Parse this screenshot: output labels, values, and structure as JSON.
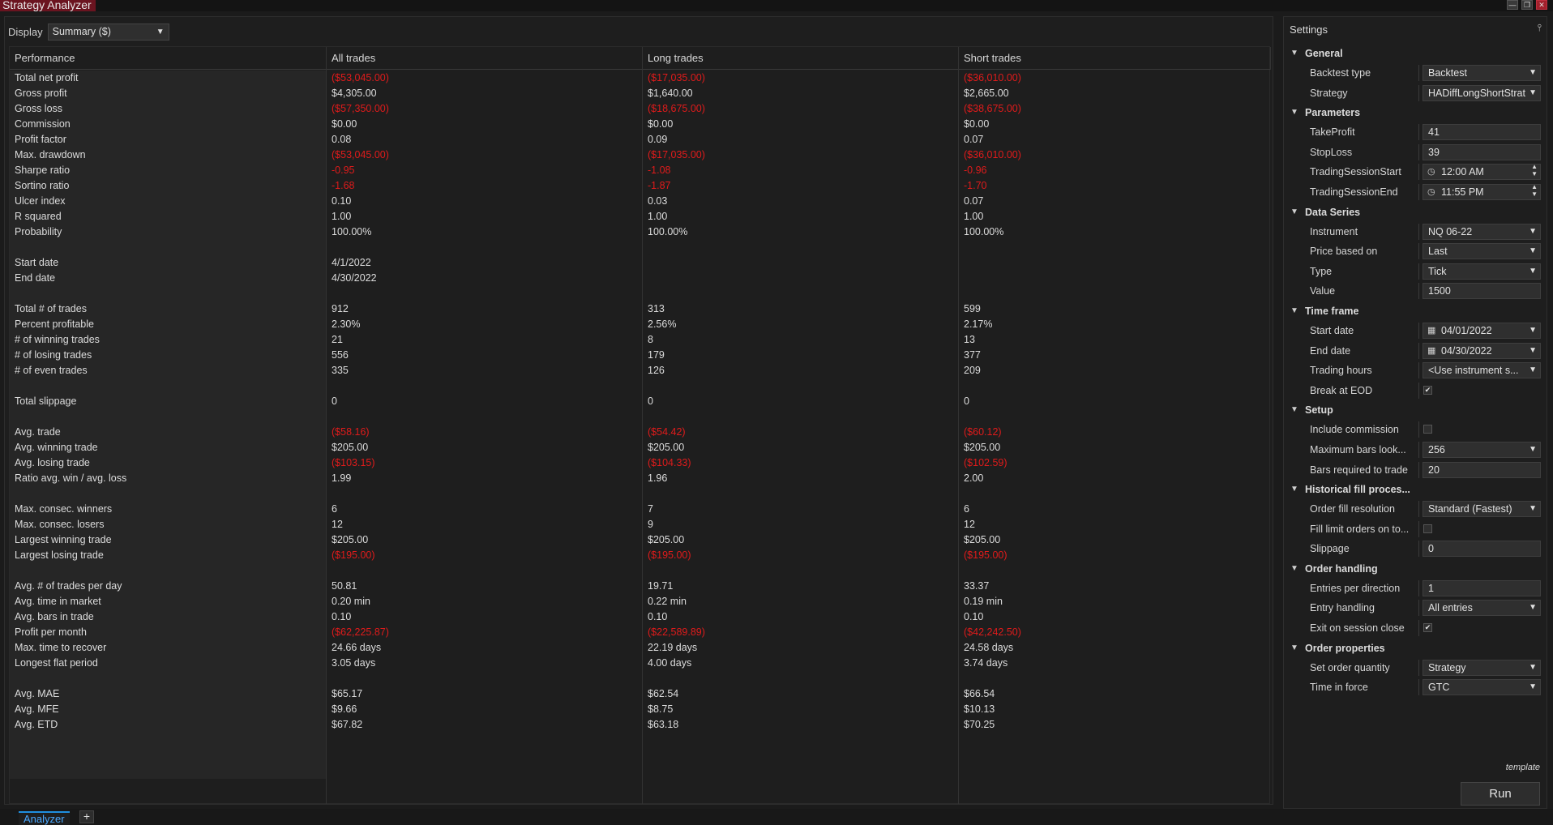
{
  "window": {
    "title": "Strategy Analyzer",
    "min_glyph": "—",
    "restore_glyph": "❐",
    "close_glyph": "✕"
  },
  "display": {
    "label": "Display",
    "selected": "Summary ($)"
  },
  "table": {
    "headers": [
      "Performance",
      "All trades",
      "Long trades",
      "Short trades"
    ],
    "rows": [
      {
        "label": "Total net profit",
        "all": "($53,045.00)",
        "long": "($17,035.00)",
        "short": "($36,010.00)"
      },
      {
        "label": "Gross profit",
        "all": "$4,305.00",
        "long": "$1,640.00",
        "short": "$2,665.00"
      },
      {
        "label": "Gross loss",
        "all": "($57,350.00)",
        "long": "($18,675.00)",
        "short": "($38,675.00)"
      },
      {
        "label": "Commission",
        "all": "$0.00",
        "long": "$0.00",
        "short": "$0.00"
      },
      {
        "label": "Profit factor",
        "all": "0.08",
        "long": "0.09",
        "short": "0.07"
      },
      {
        "label": "Max. drawdown",
        "all": "($53,045.00)",
        "long": "($17,035.00)",
        "short": "($36,010.00)"
      },
      {
        "label": "Sharpe ratio",
        "all": "-0.95",
        "long": "-1.08",
        "short": "-0.96"
      },
      {
        "label": "Sortino ratio",
        "all": "-1.68",
        "long": "-1.87",
        "short": "-1.70"
      },
      {
        "label": "Ulcer index",
        "all": "0.10",
        "long": "0.03",
        "short": "0.07"
      },
      {
        "label": "R squared",
        "all": "1.00",
        "long": "1.00",
        "short": "1.00"
      },
      {
        "label": "Probability",
        "all": "100.00%",
        "long": "100.00%",
        "short": "100.00%"
      },
      {
        "label": "",
        "all": "",
        "long": "",
        "short": ""
      },
      {
        "label": "Start date",
        "all": "4/1/2022",
        "long": "",
        "short": ""
      },
      {
        "label": "End date",
        "all": "4/30/2022",
        "long": "",
        "short": ""
      },
      {
        "label": "",
        "all": "",
        "long": "",
        "short": ""
      },
      {
        "label": "Total # of trades",
        "all": "912",
        "long": "313",
        "short": "599"
      },
      {
        "label": "Percent profitable",
        "all": "2.30%",
        "long": "2.56%",
        "short": "2.17%"
      },
      {
        "label": "# of winning trades",
        "all": "21",
        "long": "8",
        "short": "13"
      },
      {
        "label": "# of losing trades",
        "all": "556",
        "long": "179",
        "short": "377"
      },
      {
        "label": "# of even trades",
        "all": "335",
        "long": "126",
        "short": "209"
      },
      {
        "label": "",
        "all": "",
        "long": "",
        "short": ""
      },
      {
        "label": "Total slippage",
        "all": "0",
        "long": "0",
        "short": "0"
      },
      {
        "label": "",
        "all": "",
        "long": "",
        "short": ""
      },
      {
        "label": "Avg. trade",
        "all": "($58.16)",
        "long": "($54.42)",
        "short": "($60.12)"
      },
      {
        "label": "Avg. winning trade",
        "all": "$205.00",
        "long": "$205.00",
        "short": "$205.00"
      },
      {
        "label": "Avg. losing trade",
        "all": "($103.15)",
        "long": "($104.33)",
        "short": "($102.59)"
      },
      {
        "label": "Ratio avg. win / avg. loss",
        "all": "1.99",
        "long": "1.96",
        "short": "2.00"
      },
      {
        "label": "",
        "all": "",
        "long": "",
        "short": ""
      },
      {
        "label": "Max. consec. winners",
        "all": "6",
        "long": "7",
        "short": "6"
      },
      {
        "label": "Max. consec. losers",
        "all": "12",
        "long": "9",
        "short": "12"
      },
      {
        "label": "Largest winning trade",
        "all": "$205.00",
        "long": "$205.00",
        "short": "$205.00"
      },
      {
        "label": "Largest losing trade",
        "all": "($195.00)",
        "long": "($195.00)",
        "short": "($195.00)"
      },
      {
        "label": "",
        "all": "",
        "long": "",
        "short": ""
      },
      {
        "label": "Avg. # of trades per day",
        "all": "50.81",
        "long": "19.71",
        "short": "33.37"
      },
      {
        "label": "Avg. time in market",
        "all": "0.20 min",
        "long": "0.22 min",
        "short": "0.19 min"
      },
      {
        "label": "Avg. bars in trade",
        "all": "0.10",
        "long": "0.10",
        "short": "0.10"
      },
      {
        "label": "Profit per month",
        "all": "($62,225.87)",
        "long": "($22,589.89)",
        "short": "($42,242.50)"
      },
      {
        "label": "Max. time to recover",
        "all": "24.66 days",
        "long": "22.19 days",
        "short": "24.58 days"
      },
      {
        "label": "Longest flat period",
        "all": "3.05 days",
        "long": "4.00 days",
        "short": "3.74 days"
      },
      {
        "label": "",
        "all": "",
        "long": "",
        "short": ""
      },
      {
        "label": "Avg. MAE",
        "all": "$65.17",
        "long": "$62.54",
        "short": "$66.54"
      },
      {
        "label": "Avg. MFE",
        "all": "$9.66",
        "long": "$8.75",
        "short": "$10.13"
      },
      {
        "label": "Avg. ETD",
        "all": "$67.82",
        "long": "$63.18",
        "short": "$70.25"
      }
    ]
  },
  "settings": {
    "title": "Settings",
    "pin_glyph": "📌",
    "sections": [
      {
        "title": "General",
        "props": [
          {
            "label": "Backtest type",
            "value": "Backtest",
            "kind": "select"
          },
          {
            "label": "Strategy",
            "value": "HADiffLongShortStrat",
            "kind": "select"
          }
        ]
      },
      {
        "title": "Parameters",
        "props": [
          {
            "label": "TakeProfit",
            "value": "41",
            "kind": "text"
          },
          {
            "label": "StopLoss",
            "value": "39",
            "kind": "text"
          },
          {
            "label": "TradingSessionStart",
            "value": "12:00 AM",
            "kind": "time"
          },
          {
            "label": "TradingSessionEnd",
            "value": "11:55 PM",
            "kind": "time"
          }
        ]
      },
      {
        "title": "Data Series",
        "props": [
          {
            "label": "Instrument",
            "value": "NQ 06-22",
            "kind": "select"
          },
          {
            "label": "Price based on",
            "value": "Last",
            "kind": "select"
          },
          {
            "label": "Type",
            "value": "Tick",
            "kind": "select"
          },
          {
            "label": "Value",
            "value": "1500",
            "kind": "text"
          }
        ]
      },
      {
        "title": "Time frame",
        "props": [
          {
            "label": "Start date",
            "value": "04/01/2022",
            "kind": "date"
          },
          {
            "label": "End date",
            "value": "04/30/2022",
            "kind": "date"
          },
          {
            "label": "Trading hours",
            "value": "<Use instrument s...",
            "kind": "select"
          },
          {
            "label": "Break at EOD",
            "value": "✔",
            "kind": "check"
          }
        ]
      },
      {
        "title": "Setup",
        "props": [
          {
            "label": "Include commission",
            "value": "",
            "kind": "check"
          },
          {
            "label": "Maximum bars look...",
            "value": "256",
            "kind": "select"
          },
          {
            "label": "Bars required to trade",
            "value": "20",
            "kind": "text"
          }
        ]
      },
      {
        "title": "Historical fill proces...",
        "props": [
          {
            "label": "Order fill resolution",
            "value": "Standard (Fastest)",
            "kind": "select"
          },
          {
            "label": "Fill limit orders on to...",
            "value": "",
            "kind": "check"
          },
          {
            "label": "Slippage",
            "value": "0",
            "kind": "text"
          }
        ]
      },
      {
        "title": "Order handling",
        "props": [
          {
            "label": "Entries per direction",
            "value": "1",
            "kind": "text"
          },
          {
            "label": "Entry handling",
            "value": "All entries",
            "kind": "select"
          },
          {
            "label": "Exit on session close",
            "value": "✔",
            "kind": "check"
          }
        ]
      },
      {
        "title": "Order properties",
        "props": [
          {
            "label": "Set order quantity",
            "value": "Strategy",
            "kind": "select"
          },
          {
            "label": "Time in force",
            "value": "GTC",
            "kind": "select"
          }
        ]
      }
    ],
    "template_label": "template",
    "run_label": "Run"
  },
  "tabs": {
    "active": "Analyzer",
    "add_glyph": "+"
  },
  "colors": {
    "negative": "#e01b1b",
    "accent": "#1f8fe0",
    "title_bg": "#6b1420"
  }
}
